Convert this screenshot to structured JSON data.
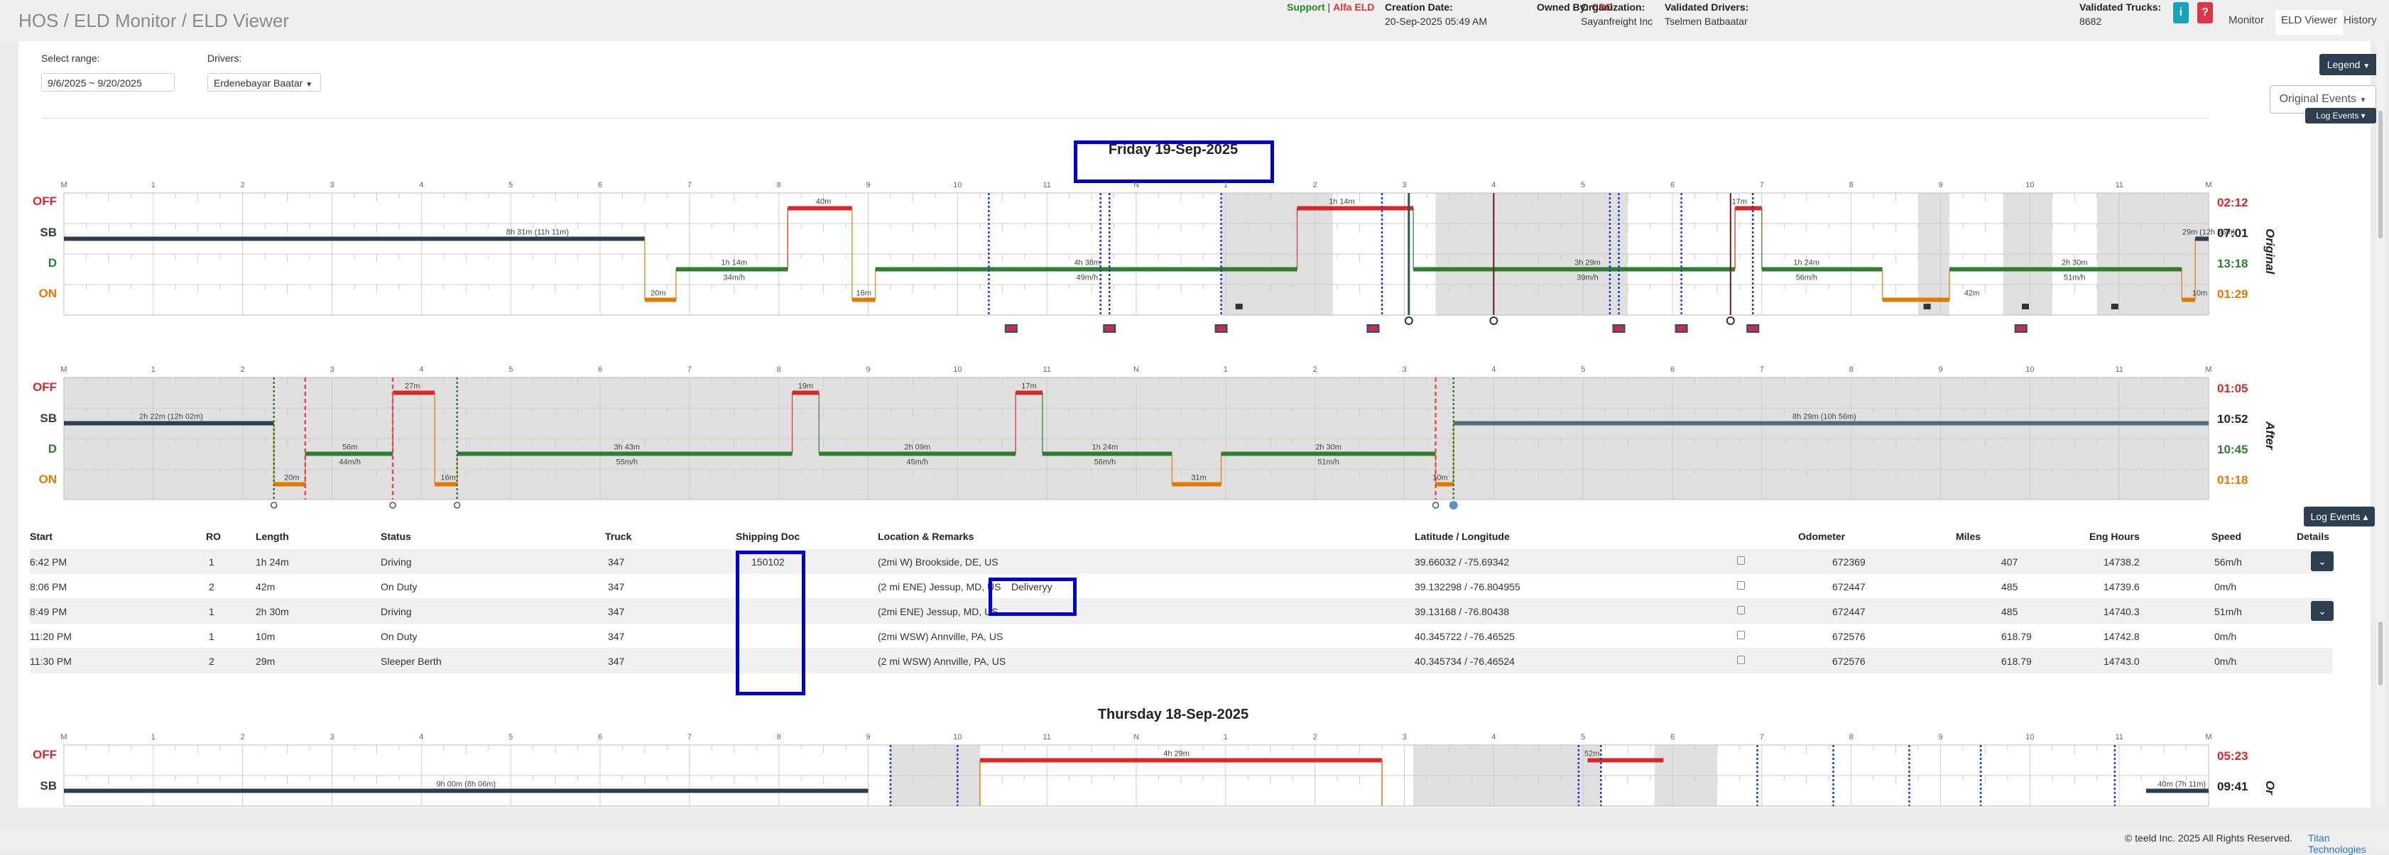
{
  "header": {
    "breadcrumb": "HOS / ELD Monitor / ELD Viewer",
    "support": "Support",
    "separator": "|",
    "alfa": "Alfa ELD",
    "creation_label": "Creation Date:",
    "creation_value": "20-Sep-2025 05:49 AM",
    "owned_label": "Owned By:",
    "owned_value": "CDD",
    "org_label": "Organization:",
    "org_value": "Sayanfreight Inc",
    "validated_label": "Validated Drivers:",
    "validated_value": "Tselmen Batbaatar",
    "trucks_label": "Validated Trucks:",
    "trucks_value": "8682",
    "info_icon": "i",
    "help_icon": "?",
    "tabs": [
      "Monitor",
      "ELD Viewer",
      "History"
    ],
    "colors": {
      "info": "#17a2b8",
      "help": "#dc3545",
      "active_tab": "#ffffff"
    }
  },
  "filters": {
    "range_label": "Select range:",
    "range_value": "9/6/2025 ~ 9/20/2025",
    "drivers_label": "Drivers:",
    "driver_value": "Erdenebayar Baatar",
    "legend_button": "Legend",
    "original_events": "Original Events",
    "log_events_button": "Log Events"
  },
  "grid": {
    "hour_labels": [
      "M",
      "1",
      "2",
      "3",
      "4",
      "5",
      "6",
      "7",
      "8",
      "9",
      "10",
      "11",
      "N",
      "1",
      "2",
      "3",
      "4",
      "5",
      "6",
      "7",
      "8",
      "9",
      "10",
      "11",
      "M"
    ],
    "row_labels": [
      "OFF",
      "SB",
      "D",
      "ON"
    ],
    "colors": {
      "OFF": "#d62828",
      "SB": "#2c3e50",
      "D": "#2e7d32",
      "ON": "#e07b00",
      "shade": "#e0e0e0",
      "dotted": "#1a3fcc",
      "driving_line": "#4a7a3a",
      "offline_line": "#5a6a78"
    }
  },
  "days": [
    {
      "title": "Friday 19-Sep-2025",
      "side": "Original",
      "totals": {
        "OFF": "02:12",
        "SB": "07:01",
        "D": "13:18",
        "ON": "01:29"
      },
      "labels": [
        {
          "t": "8h 31m (11h 11m)",
          "h": 5.3,
          "r": 1
        },
        {
          "t": "20m",
          "h": 6.65,
          "r": 3
        },
        {
          "t": "1h 14m",
          "h": 7.5,
          "r": 2
        },
        {
          "t": "34m/h",
          "h": 7.5,
          "r": 2.4
        },
        {
          "t": "40m",
          "h": 8.5,
          "r": 0
        },
        {
          "t": "16m",
          "h": 8.95,
          "r": 3
        },
        {
          "t": "4h 38m",
          "h": 11.45,
          "r": 2
        },
        {
          "t": "49m/h",
          "h": 11.45,
          "r": 2.4
        },
        {
          "t": "1h 14m",
          "h": 14.3,
          "r": 0
        },
        {
          "t": "3h 29m",
          "h": 17.05,
          "r": 2
        },
        {
          "t": "39m/h",
          "h": 17.05,
          "r": 2.4
        },
        {
          "t": "17m",
          "h": 18.75,
          "r": 0
        },
        {
          "t": "1h 24m",
          "h": 19.5,
          "r": 2
        },
        {
          "t": "56m/h",
          "h": 19.5,
          "r": 2.4
        },
        {
          "t": "42m",
          "h": 21.35,
          "r": 3
        },
        {
          "t": "2h 30m",
          "h": 22.5,
          "r": 2
        },
        {
          "t": "51m/h",
          "h": 22.5,
          "r": 2.4
        },
        {
          "t": "10m",
          "h": 23.9,
          "r": 3
        },
        {
          "t": "29m (12h 56m)",
          "h": 24.0,
          "r": 1
        }
      ]
    },
    {
      "title": "",
      "side": "After",
      "totals": {
        "OFF": "01:05",
        "SB": "10:52",
        "D": "10:45",
        "ON": "01:18"
      },
      "labels": [
        {
          "t": "2h 22m (12h 02m)",
          "h": 1.2,
          "r": 1
        },
        {
          "t": "20m",
          "h": 2.55,
          "r": 3
        },
        {
          "t": "56m",
          "h": 3.2,
          "r": 2
        },
        {
          "t": "44m/h",
          "h": 3.2,
          "r": 2.4
        },
        {
          "t": "27m",
          "h": 3.9,
          "r": 0
        },
        {
          "t": "16m",
          "h": 4.3,
          "r": 3
        },
        {
          "t": "3h 43m",
          "h": 6.3,
          "r": 2
        },
        {
          "t": "55m/h",
          "h": 6.3,
          "r": 2.4
        },
        {
          "t": "19m",
          "h": 8.3,
          "r": 0
        },
        {
          "t": "2h 09m",
          "h": 9.55,
          "r": 2
        },
        {
          "t": "45m/h",
          "h": 9.55,
          "r": 2.4
        },
        {
          "t": "17m",
          "h": 10.8,
          "r": 0
        },
        {
          "t": "1h 24m",
          "h": 11.65,
          "r": 2
        },
        {
          "t": "56m/h",
          "h": 11.65,
          "r": 2.4
        },
        {
          "t": "31m",
          "h": 12.7,
          "r": 3
        },
        {
          "t": "2h 30m",
          "h": 14.15,
          "r": 2
        },
        {
          "t": "51m/h",
          "h": 14.15,
          "r": 2.4
        },
        {
          "t": "10m",
          "h": 15.4,
          "r": 3
        },
        {
          "t": "8h 29m (10h 56m)",
          "h": 19.7,
          "r": 1
        }
      ]
    },
    {
      "title": "Thursday 18-Sep-2025",
      "side": "Or",
      "totals": {
        "OFF": "05:23",
        "SB": "09:41"
      },
      "labels": [
        {
          "t": "4h 29m",
          "h": 12.45,
          "r": 0
        },
        {
          "t": "52m",
          "h": 17.1,
          "r": 0
        },
        {
          "t": "9h 00m (8h 06m)",
          "h": 4.5,
          "r": 1
        },
        {
          "t": "40m (7h 11m)",
          "h": 23.7,
          "r": 1
        }
      ]
    }
  ],
  "table": {
    "columns": [
      "Start",
      "RO",
      "Length",
      "Status",
      "Truck",
      "Shipping Doc",
      "Location & Remarks",
      "Latitude / Longitude",
      "Odometer",
      "Miles",
      "Eng Hours",
      "Speed",
      "Details"
    ],
    "rows": [
      {
        "start": "6:42 PM",
        "ro": "1",
        "length": "1h 24m",
        "status": "Driving",
        "truck": "347",
        "doc": "150102",
        "loc": "(2mi W) Brookside, DE, US",
        "remark": "",
        "latlng": "39.66032 / -75.69342",
        "odo": "672369",
        "miles": "407",
        "eng": "14738.2",
        "speed": "56m/h",
        "details": true
      },
      {
        "start": "8:06 PM",
        "ro": "2",
        "length": "42m",
        "status": "On Duty",
        "truck": "347",
        "doc": "",
        "loc": "(2 mi ENE) Jessup, MD, US",
        "remark": "Deliveryy",
        "latlng": "39.132298 / -76.804955",
        "odo": "672447",
        "miles": "485",
        "eng": "14739.6",
        "speed": "0m/h",
        "details": false
      },
      {
        "start": "8:49 PM",
        "ro": "1",
        "length": "2h 30m",
        "status": "Driving",
        "truck": "347",
        "doc": "",
        "loc": "(2mi ENE) Jessup, MD, US",
        "remark": "",
        "latlng": "39.13168 / -76.80438",
        "odo": "672447",
        "miles": "485",
        "eng": "14740.3",
        "speed": "51m/h",
        "details": true
      },
      {
        "start": "11:20 PM",
        "ro": "1",
        "length": "10m",
        "status": "On Duty",
        "truck": "347",
        "doc": "",
        "loc": "(2mi WSW) Annville, PA, US",
        "remark": "",
        "latlng": "40.345722 / -76.46525",
        "odo": "672576",
        "miles": "618.79",
        "eng": "14742.8",
        "speed": "0m/h",
        "details": false
      },
      {
        "start": "11:30 PM",
        "ro": "2",
        "length": "29m",
        "status": "Sleeper Berth",
        "truck": "347",
        "doc": "",
        "loc": "(2 mi WSW) Annville, PA, US",
        "remark": "",
        "latlng": "40.345734 / -76.46524",
        "odo": "672576",
        "miles": "618.79",
        "eng": "14743.0",
        "speed": "0m/h",
        "details": false
      }
    ]
  },
  "footer": {
    "copyright": "© teeld Inc. 2025 All Rights Reserved.",
    "brand": "Titan Technologies"
  }
}
